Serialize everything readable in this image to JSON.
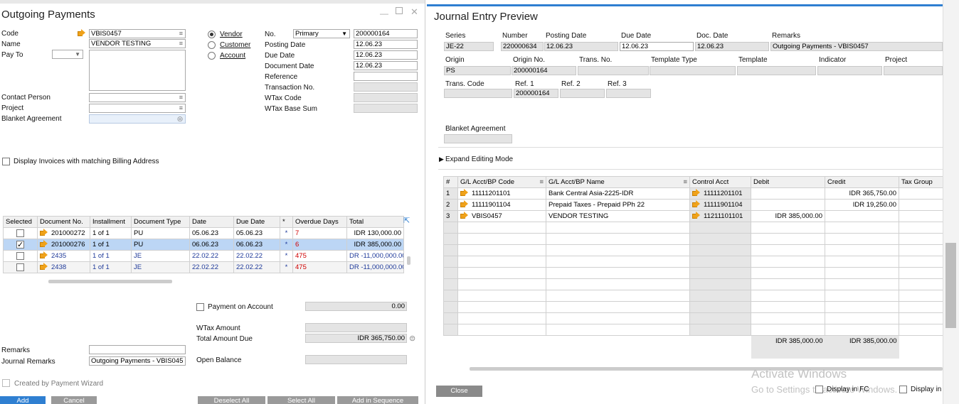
{
  "op": {
    "title": "Outgoing Payments",
    "code_label": "Code",
    "code_value": "VBIS0457",
    "name_label": "Name",
    "name_value": "VENDOR TESTING",
    "payto_label": "Pay To",
    "contact_label": "Contact Person",
    "project_label": "Project",
    "blanket_label": "Blanket Agreement",
    "radio_vendor": "Vendor",
    "radio_customer": "Customer",
    "radio_account": "Account",
    "no_label": "No.",
    "no_series": "Primary",
    "no_value": "200000164",
    "posting_label": "Posting Date",
    "posting_value": "12.06.23",
    "due_label": "Due Date",
    "due_value": "12.06.23",
    "docdate_label": "Document Date",
    "docdate_value": "12.06.23",
    "reference_label": "Reference",
    "transno_label": "Transaction No.",
    "wtaxcode_label": "WTax Code",
    "wtaxbase_label": "WTax Base Sum",
    "display_invoices": "Display Invoices with matching Billing Address",
    "table_headers": [
      "Selected",
      "Document No.",
      "Installment",
      "Document Type",
      "Date",
      "Due Date",
      "*",
      "Overdue Days",
      "Total"
    ],
    "rows": [
      {
        "checked": false,
        "doc": "201000272",
        "inst": "1 of 1",
        "type": "PU",
        "date": "05.06.23",
        "due": "05.06.23",
        "star": "*",
        "overdue": "7",
        "total": "IDR 130,000.00"
      },
      {
        "checked": true,
        "doc": "201000276",
        "inst": "1 of 1",
        "type": "PU",
        "date": "06.06.23",
        "due": "06.06.23",
        "star": "*",
        "overdue": "6",
        "total": "IDR 385,000.00"
      },
      {
        "checked": false,
        "doc": "2435",
        "inst": "1 of 1",
        "type": "JE",
        "date": "22.02.22",
        "due": "22.02.22",
        "star": "*",
        "overdue": "475",
        "total": "DR -11,000,000.00"
      },
      {
        "checked": false,
        "doc": "2438",
        "inst": "1 of 1",
        "type": "JE",
        "date": "22.02.22",
        "due": "22.02.22",
        "star": "*",
        "overdue": "475",
        "total": "DR -11,000,000.00"
      }
    ],
    "payment_on_account": "Payment on Account",
    "payment_on_account_value": "0.00",
    "wtax_amount": "WTax Amount",
    "total_due": "Total Amount Due",
    "total_due_value": "IDR 365,750.00",
    "open_balance": "Open Balance",
    "remarks_label": "Remarks",
    "journal_remarks_label": "Journal Remarks",
    "journal_remarks_value": "Outgoing Payments - VBIS045",
    "created_by_wizard": "Created by Payment Wizard",
    "btn_add": "Add",
    "btn_cancel": "Cancel",
    "btn_deselect": "Deselect All",
    "btn_select": "Select All",
    "btn_add_seq": "Add in Sequence"
  },
  "je": {
    "title": "Journal Entry Preview",
    "series_label": "Series",
    "series_value": "JE-22",
    "number_label": "Number",
    "number_value": "220000634",
    "posting_label": "Posting Date",
    "posting_value": "12.06.23",
    "due_label": "Due Date",
    "due_value": "12.06.23",
    "docdate_label": "Doc. Date",
    "docdate_value": "12.06.23",
    "remarks_label": "Remarks",
    "remarks_value": "Outgoing Payments - VBIS0457",
    "origin_label": "Origin",
    "origin_value": "PS",
    "originno_label": "Origin No.",
    "originno_value": "200000164",
    "transno_label": "Trans. No.",
    "templtype_label": "Template Type",
    "template_label": "Template",
    "indicator_label": "Indicator",
    "project_label": "Project",
    "transcode_label": "Trans. Code",
    "ref1_label": "Ref. 1",
    "ref1_value": "200000164",
    "ref2_label": "Ref. 2",
    "ref3_label": "Ref. 3",
    "blanket_label": "Blanket Agreement",
    "expand_label": "Expand Editing Mode",
    "headers": [
      "#",
      "G/L Acct/BP Code",
      "G/L Acct/BP Name",
      "Control Acct",
      "Debit",
      "Credit",
      "Tax Group"
    ],
    "rows": [
      {
        "n": "1",
        "code": "11111201101",
        "name": "Bank Central Asia-2225-IDR",
        "ctrl": "11111201101",
        "debit": "",
        "credit": "IDR 365,750.00"
      },
      {
        "n": "2",
        "code": "11111901104",
        "name": "Prepaid Taxes - Prepaid PPh 22",
        "ctrl": "11111901104",
        "debit": "",
        "credit": "IDR 19,250.00"
      },
      {
        "n": "3",
        "code": "VBIS0457",
        "name": "VENDOR TESTING",
        "ctrl": "11211101101",
        "debit": "IDR 385,000.00",
        "credit": ""
      }
    ],
    "total_debit": "IDR 385,000.00",
    "total_credit": "IDR 385,000.00",
    "btn_close": "Close",
    "display_in_fc": "Display in FC",
    "display_in": "Display in",
    "watermark1": "Activate Windows",
    "watermark2": "Go to Settings to activate Windows."
  }
}
